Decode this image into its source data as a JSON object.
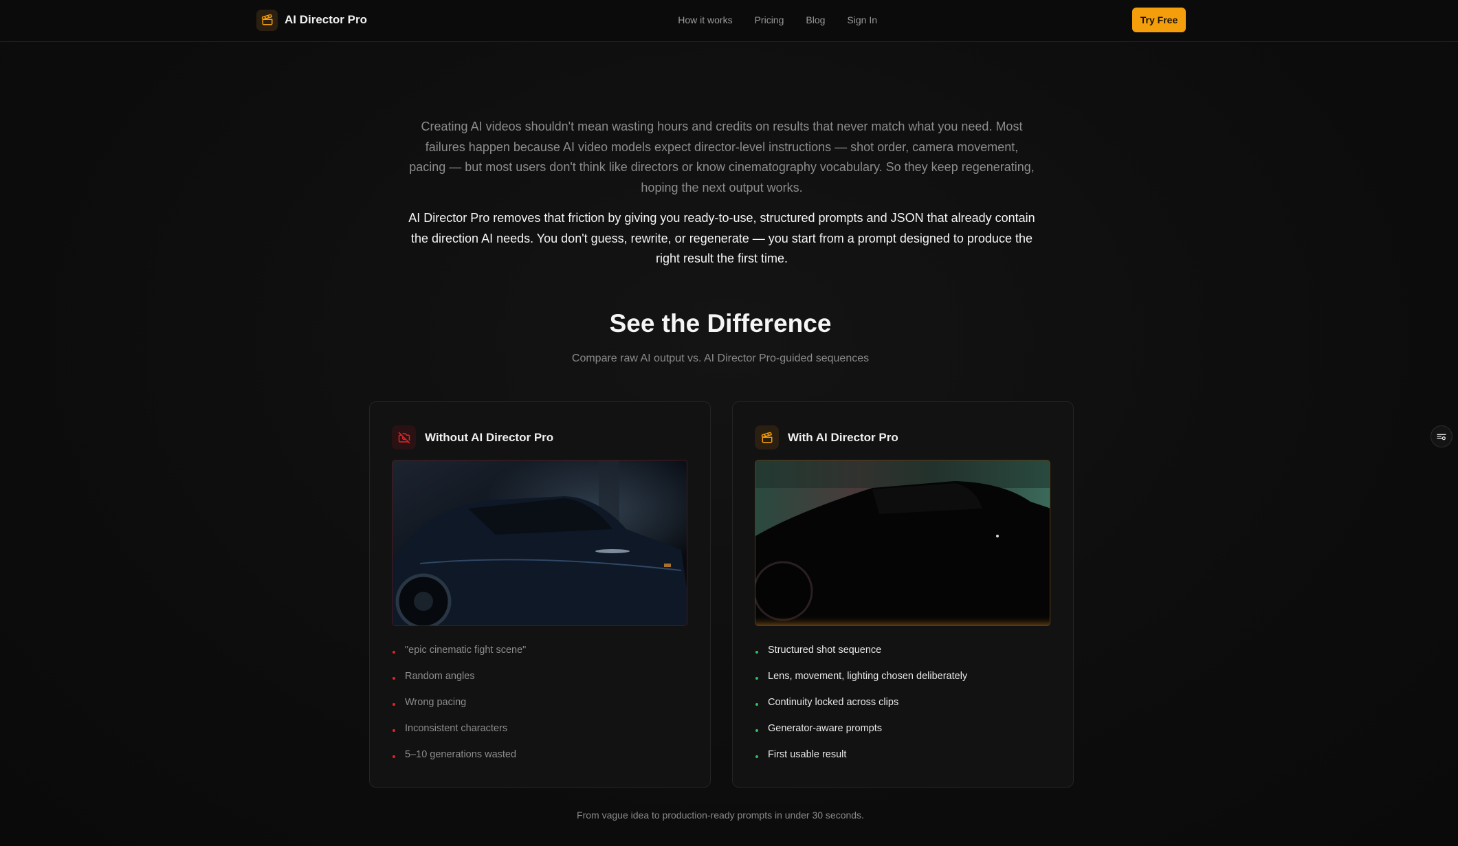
{
  "nav": {
    "brand": "AI Director Pro",
    "links": [
      "How it works",
      "Pricing",
      "Blog",
      "Sign In"
    ],
    "cta": "Try Free"
  },
  "intro": {
    "muted": "Creating AI videos shouldn't mean wasting hours and credits on results that never match what you need. Most failures happen because AI video models expect director-level instructions — shot order, camera movement, pacing — but most users don't think like directors or know cinematography vocabulary. So they keep regenerating, hoping the next output works.",
    "strong": "AI Director Pro removes that friction by giving you ready-to-use, structured prompts and JSON that already contain the direction AI needs. You don't guess, rewrite, or regenerate — you start from a prompt designed to produce the right result the first time."
  },
  "section": {
    "title": "See the Difference",
    "subtitle": "Compare raw AI output vs. AI Director Pro-guided sequences"
  },
  "without": {
    "title": "Without AI Director Pro",
    "icon": "camera-off-icon",
    "items": [
      "\"epic cinematic fight scene\"",
      "Random angles",
      "Wrong pacing",
      "Inconsistent characters",
      "5–10 generations wasted"
    ]
  },
  "with": {
    "title": "With AI Director Pro",
    "icon": "clapperboard-icon",
    "items": [
      "Structured shot sequence",
      "Lens, movement, lighting chosen deliberately",
      "Continuity locked across clips",
      "Generator-aware prompts",
      "First usable result"
    ]
  },
  "footnote": "From vague idea to production-ready prompts in under 30 seconds.",
  "colors": {
    "accent": "#f59e0b",
    "bad": "#dc2626",
    "good": "#22c55e"
  }
}
